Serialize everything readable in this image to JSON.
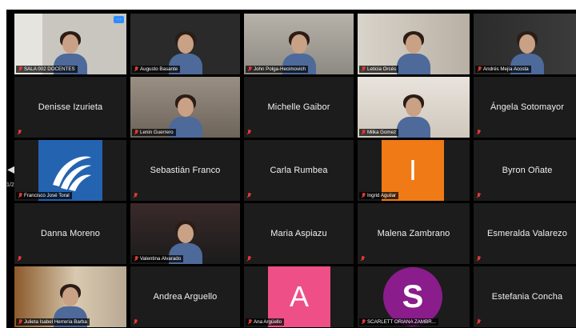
{
  "gallery": {
    "page_indicator": "1/2",
    "tiles": [
      {
        "id": "sala",
        "tag": "SALA 002 DOCENTES",
        "scene": "room",
        "has_more": true
      },
      {
        "id": "augusto",
        "tag": "Augusto Basante",
        "scene": "poster"
      },
      {
        "id": "john",
        "tag": "John Polga-Hecimovich",
        "scene": "studio"
      },
      {
        "id": "leticia",
        "tag": "Leticia Orcés",
        "scene": "home"
      },
      {
        "id": "andres",
        "tag": "Andrés Mejía Acosta",
        "scene": "dark"
      },
      {
        "id": "denisse",
        "name": "Denisse Izurieta"
      },
      {
        "id": "lenin",
        "tag": "Lenin Guerrero",
        "scene": "wall"
      },
      {
        "id": "michelle",
        "name": "Michelle Gaibor"
      },
      {
        "id": "milka",
        "tag": "Milka Gomez",
        "scene": "light"
      },
      {
        "id": "angela",
        "name": "Ángela Sotomayor"
      },
      {
        "id": "francisco",
        "tag": "Francisco José Toral",
        "avatar": "logo",
        "color": "#2463b0"
      },
      {
        "id": "sebastian",
        "name": "Sebastián Franco"
      },
      {
        "id": "carla",
        "name": "Carla Rumbea"
      },
      {
        "id": "ingrid",
        "tag": "Ingrid Aguilar",
        "letter": "I",
        "color": "#ef7a16"
      },
      {
        "id": "byron",
        "name": "Byron Oñate"
      },
      {
        "id": "danna",
        "name": "Danna Moreno"
      },
      {
        "id": "valentina",
        "tag": "Valentina Alvarado",
        "scene": "night"
      },
      {
        "id": "maria",
        "name": "Maria Aspiazu"
      },
      {
        "id": "malena",
        "name": "Malena Zambrano"
      },
      {
        "id": "esmeralda",
        "name": "Esmeralda Valarezo"
      },
      {
        "id": "julieta",
        "tag": "Julieta Isabel Herrería Barba",
        "scene": "office",
        "speaking": true
      },
      {
        "id": "andrea",
        "name": "Andrea Arguello"
      },
      {
        "id": "ana",
        "tag": "Ana Argüello",
        "letter": "A",
        "color": "#ee4f86"
      },
      {
        "id": "scarlett",
        "tag": "SCARLETT ORIANA ZAMBR...",
        "circle": "S",
        "color": "#8a1c8b"
      },
      {
        "id": "estefania",
        "name": "Estefania Concha"
      }
    ]
  }
}
